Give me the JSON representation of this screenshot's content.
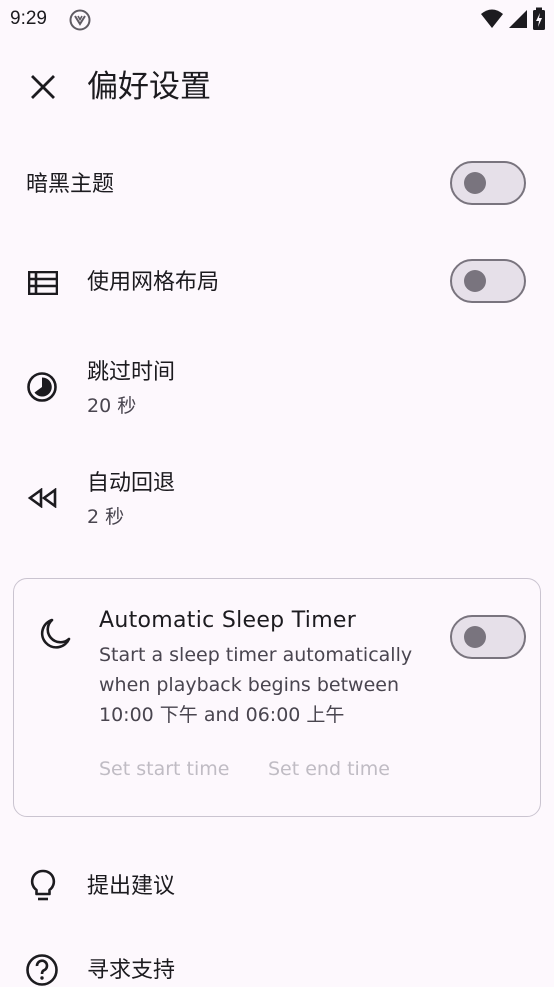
{
  "status": {
    "time": "9:29"
  },
  "header": {
    "title": "偏好设置"
  },
  "settings": {
    "dark_theme": {
      "label": "暗黑主题",
      "on": false
    },
    "grid_layout": {
      "label": "使用网格布局",
      "on": false
    },
    "skip_time": {
      "label": "跳过时间",
      "value": "20 秒"
    },
    "auto_rewind": {
      "label": "自动回退",
      "value": "2 秒"
    }
  },
  "sleep_timer": {
    "title": "Automatic Sleep Timer",
    "desc_lines": [
      "Start a sleep timer automatically",
      "when playback begins between",
      "10:00 下午 and 06:00 上午"
    ],
    "on": false,
    "start_button": "Set start time",
    "end_button": "Set end time"
  },
  "links": {
    "suggest": "提出建议",
    "support": "寻求支持"
  },
  "icons": [
    "close-icon",
    "list-icon",
    "clock-icon",
    "rewind-icon",
    "moon-icon",
    "lightbulb-icon",
    "help-icon"
  ]
}
